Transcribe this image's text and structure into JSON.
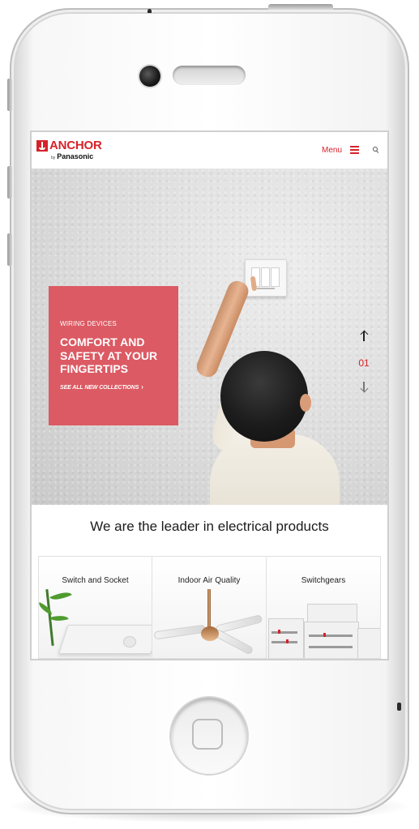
{
  "brand": {
    "name": "ANCHOR",
    "by": "by",
    "parent": "Panasonic",
    "color": "#d6232a"
  },
  "header": {
    "menu_label": "Menu",
    "menu_icon": "hamburger-icon",
    "search_icon": "search-icon"
  },
  "hero": {
    "eyebrow": "WIRING DEVICES",
    "title": "COMFORT AND SAFETY AT YOUR FINGERTIPS",
    "link_label": "SEE ALL NEW COLLECTIONS",
    "link_icon": "chevron-right-icon",
    "card_color": "#dc5a63",
    "slide_number": "01",
    "prev_icon": "arrow-up-icon",
    "next_icon": "arrow-down-icon"
  },
  "leader": {
    "heading": "We are the leader in electrical products"
  },
  "categories": [
    {
      "label": "Switch and Socket"
    },
    {
      "label": "Indoor Air Quality"
    },
    {
      "label": "Switchgears"
    }
  ]
}
